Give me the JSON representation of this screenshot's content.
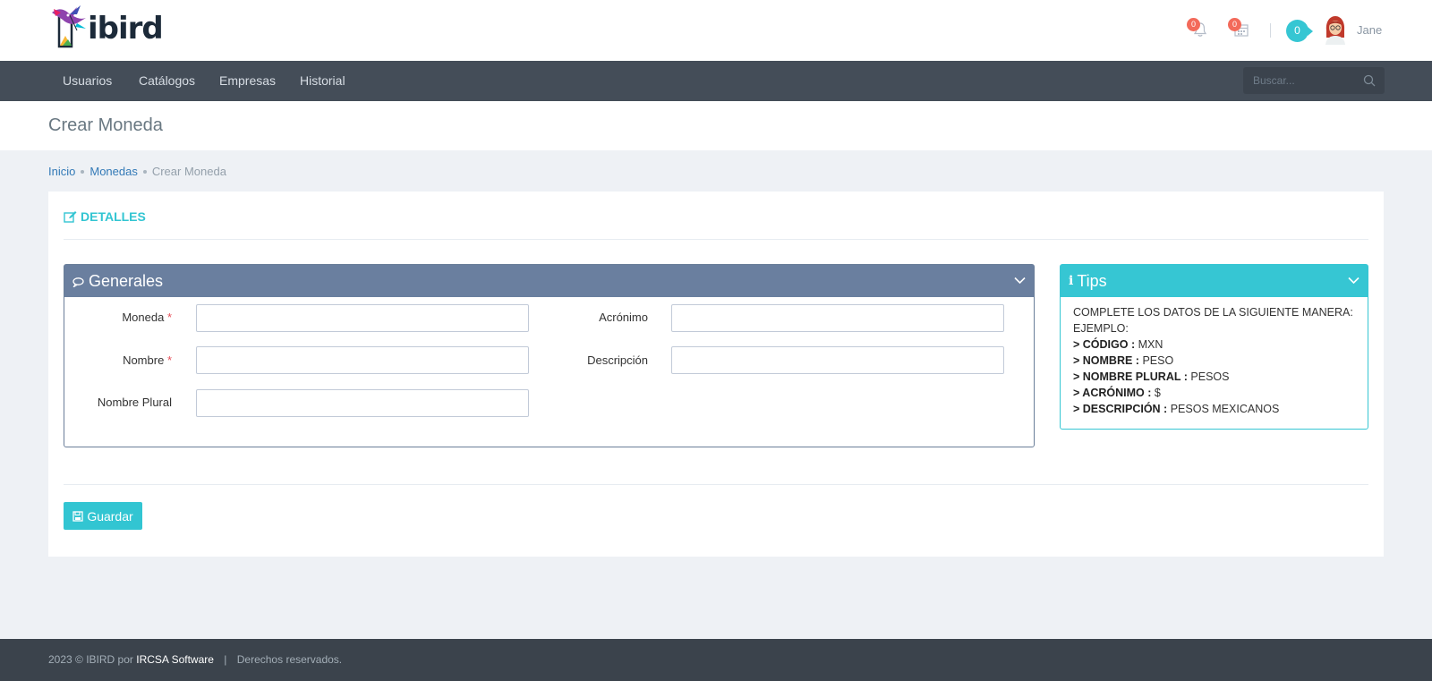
{
  "header": {
    "logo_text": "ibird",
    "notifications_count": "0",
    "calendar_count": "0",
    "messages_count": "0",
    "user_name": "Jane"
  },
  "nav": {
    "items": [
      {
        "label": "Usuarios"
      },
      {
        "label": "Catálogos"
      },
      {
        "label": "Empresas"
      },
      {
        "label": "Historial"
      }
    ],
    "search_placeholder": "Buscar..."
  },
  "page": {
    "title": "Crear Moneda"
  },
  "breadcrumb": {
    "items": [
      "Inicio",
      "Monedas",
      "Crear Moneda"
    ]
  },
  "card": {
    "section_title": "DETALLES",
    "generales": {
      "title": "Generales",
      "fields": {
        "moneda": {
          "label": "Moneda",
          "required_mark": "*",
          "value": ""
        },
        "acronimo": {
          "label": "Acrónimo",
          "value": ""
        },
        "nombre": {
          "label": "Nombre",
          "required_mark": "*",
          "value": ""
        },
        "descripcion": {
          "label": "Descripción",
          "value": ""
        },
        "nombre_plural": {
          "label": "Nombre Plural",
          "value": ""
        }
      }
    },
    "tips": {
      "title": "Tips",
      "intro": "COMPLETE LOS DATOS DE LA SIGUIENTE MANERA:",
      "example_label": "EJEMPLO:",
      "lines": [
        {
          "key": "> CÓDIGO :",
          "value": "MXN"
        },
        {
          "key": "> NOMBRE :",
          "value": "PESO"
        },
        {
          "key": "> NOMBRE PLURAL :",
          "value": "PESOS"
        },
        {
          "key": "> ACRÓNIMO :",
          "value": "$"
        },
        {
          "key": "> DESCRIPCIÓN :",
          "value": "PESOS MEXICANOS"
        }
      ]
    },
    "save_label": "Guardar"
  },
  "footer": {
    "prefix": "2023 © IBIRD por",
    "brand": "IRCSA Software",
    "separator": "|",
    "rights": "Derechos reservados."
  },
  "colors": {
    "accent": "#32c5d2",
    "nav_bg": "#444d58",
    "portlet_head": "#6a7f9f",
    "badge": "#f36a5a",
    "footer_bg": "#3b434c"
  }
}
